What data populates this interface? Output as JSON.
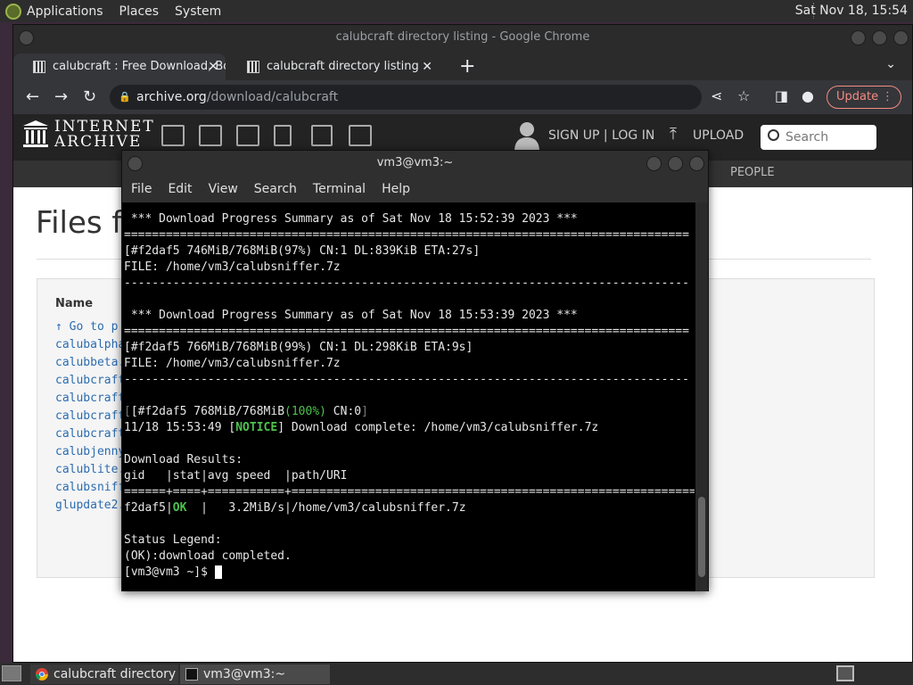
{
  "top_panel": {
    "menus": [
      "Applications",
      "Places",
      "System"
    ],
    "clock": "Sat Nov 18, 15:54"
  },
  "chrome": {
    "window_title": "calubcraft directory listing - Google Chrome",
    "tabs": [
      {
        "label": "calubcraft : Free Download, Bo"
      },
      {
        "label": "calubcraft directory listing"
      }
    ],
    "url_host": "archive.org",
    "url_path": "/download/calubcraft",
    "update_label": "Update"
  },
  "ia": {
    "wordmark_line1": "INTERNET",
    "wordmark_line2": "ARCHIVE",
    "auth": "SIGN UP | LOG IN",
    "upload": "UPLOAD",
    "search_placeholder": "Search",
    "subnav_people": "PEOPLE",
    "heading": "Files f",
    "column_name": "Name",
    "files": [
      "↑ Go to p",
      "calubalpha",
      "calubbeta.",
      "calubcraft",
      "calubcraft",
      "calubcraft",
      "calubcraft",
      "calubjenny",
      "calublite.",
      "calubsniff",
      "glupdate2."
    ]
  },
  "terminal": {
    "title": "vm3@vm3:~",
    "menu": [
      "File",
      "Edit",
      "View",
      "Search",
      "Terminal",
      "Help"
    ],
    "summary1": " *** Download Progress Summary as of Sat Nov 18 15:52:39 2023 ***",
    "rule_eq": "=================================================================================",
    "progress1": "[#f2daf5 746MiB/768MiB(97%) CN:1 DL:839KiB ETA:27s]",
    "file1": "FILE: /home/vm3/calubsniffer.7z",
    "rule_dash": "---------------------------------------------------------------------------------",
    "summary2": " *** Download Progress Summary as of Sat Nov 18 15:53:39 2023 ***",
    "progress2": "[#f2daf5 766MiB/768MiB(99%) CN:1 DL:298KiB ETA:9s]",
    "file2": "FILE: /home/vm3/calubsniffer.7z",
    "progress3_a": "[#f2daf5 768MiB/768MiB",
    "progress3_pct": "(100%)",
    "progress3_b": " CN:0",
    "progress3_end": "]",
    "notice_pre": "11/18 15:53:49 [",
    "notice_tag": "NOTICE",
    "notice_post": "] Download complete: /home/vm3/calubsniffer.7z",
    "results_header": "Download Results:",
    "results_cols": "gid   |stat|avg speed  |path/URI",
    "results_rule": "======+====+===========+==========================================================",
    "result_gid": "f2daf5|",
    "result_stat": "OK",
    "result_rest": "  |   3.2MiB/s|/home/vm3/calubsniffer.7z",
    "legend_header": "Status Legend:",
    "legend_ok": "(OK):download completed.",
    "prompt": "[vm3@vm3 ~]$ "
  },
  "taskbar": {
    "items": [
      "calubcraft directory ...",
      "vm3@vm3:~"
    ]
  }
}
